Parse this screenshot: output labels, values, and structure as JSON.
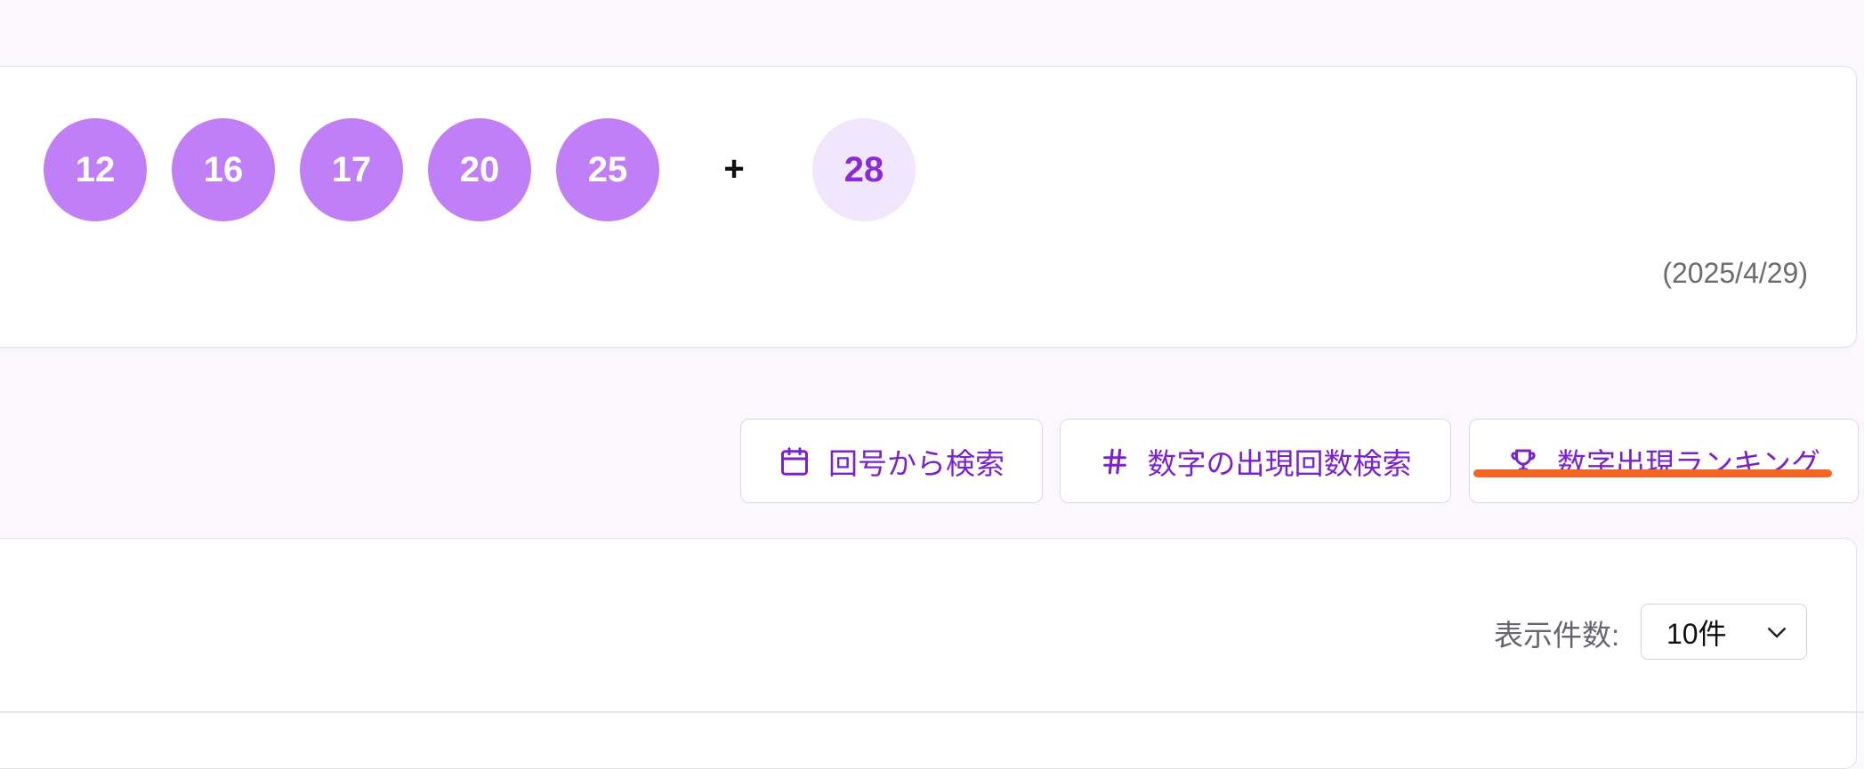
{
  "draw": {
    "main_numbers": [
      "12",
      "16",
      "17",
      "20",
      "25"
    ],
    "plus_sign": "+",
    "bonus_number": "28",
    "date": "(2025/4/29)"
  },
  "tools": {
    "search_by_round": "回号から検索",
    "count_search": "数字の出現回数検索",
    "ranking": "数字出現ランキング"
  },
  "list": {
    "per_page_label": "表示件数:",
    "per_page_value": "10件"
  },
  "colors": {
    "accent": "#7b22c9",
    "ball_main": "#c07ff6",
    "ball_bonus_bg": "#f2e6fd",
    "highlight": "#f26522"
  },
  "icons": {
    "search_by_round": "calendar-icon",
    "count_search": "hash-icon",
    "ranking": "trophy-icon",
    "per_page": "chevron-down-icon"
  }
}
